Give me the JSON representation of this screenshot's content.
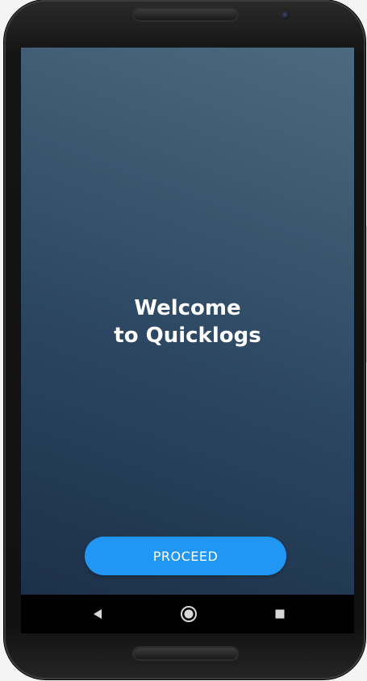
{
  "app": {
    "welcome_line1": "Welcome",
    "welcome_line2": "to Quicklogs",
    "proceed_label": "PROCEED"
  },
  "navbar": {
    "back_icon": "back-triangle",
    "home_icon": "home-circle",
    "recents_icon": "recents-square"
  },
  "colors": {
    "screen_gradient_top": "#4b6a80",
    "screen_gradient_bottom": "#1c3049",
    "button": "#2196f3",
    "text": "#ffffff"
  }
}
